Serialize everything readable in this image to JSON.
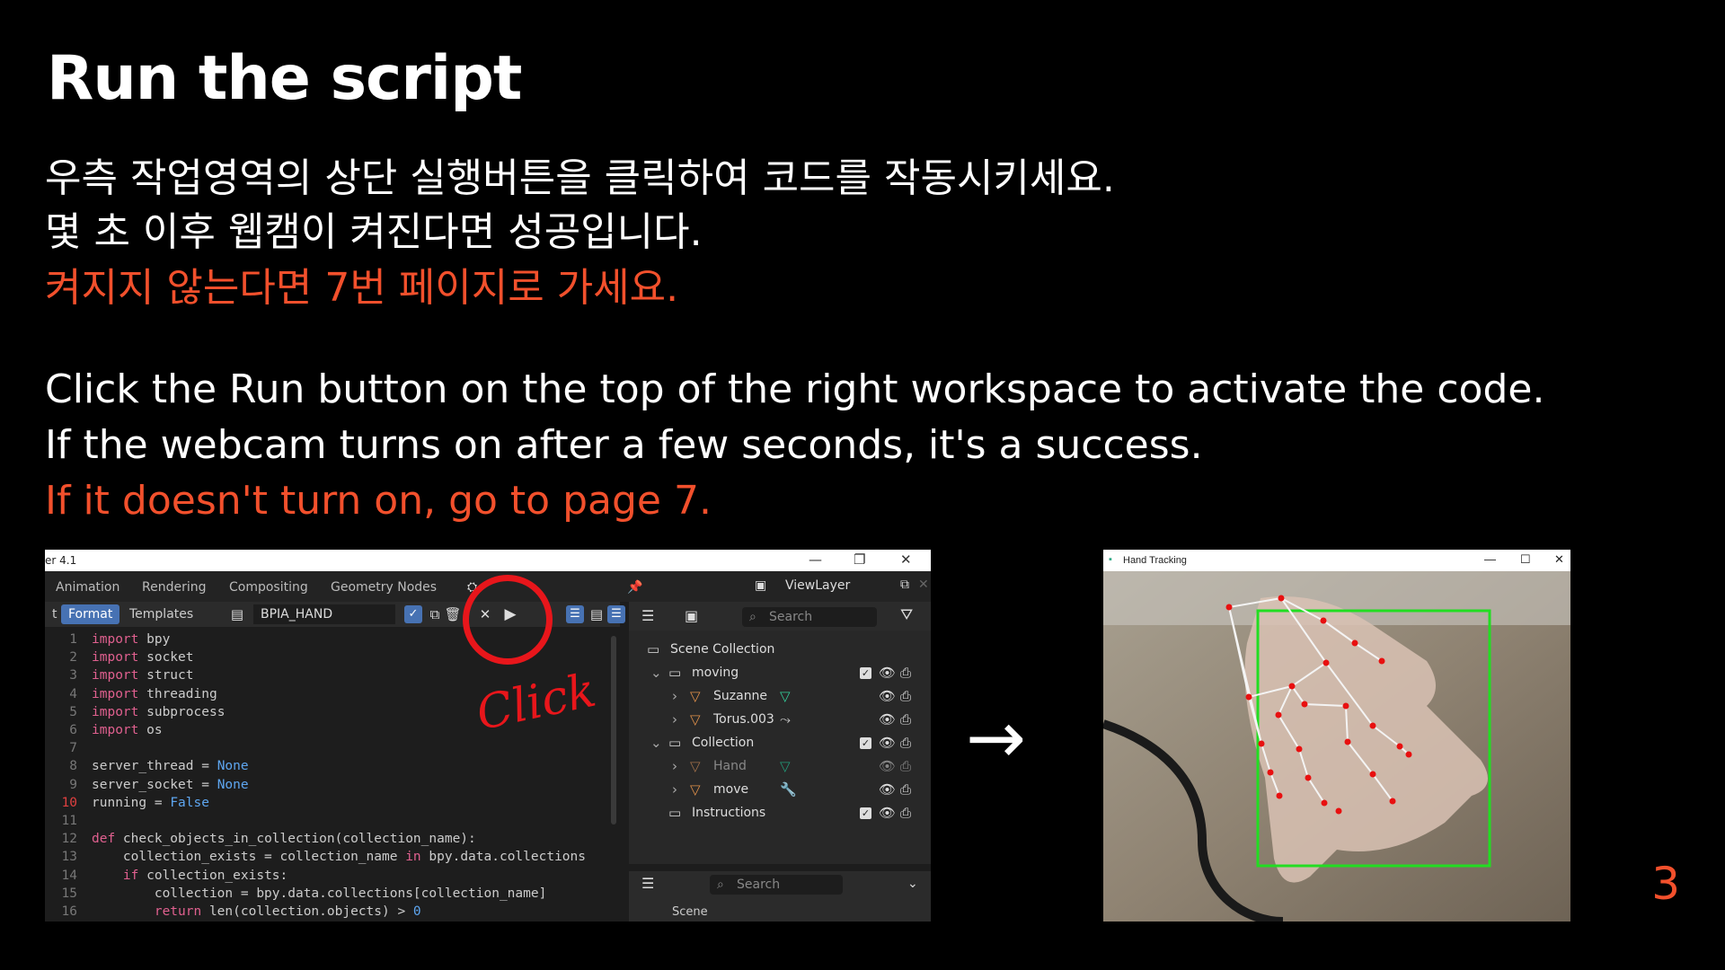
{
  "slide": {
    "title": "Run the script",
    "ko_line1": "우측 작업영역의 상단 실행버튼을 클릭하여 코드를 작동시키세요.",
    "ko_line2": "몇 초 이후 웹캠이 켜진다면 성공입니다.",
    "ko_line3": "켜지지 않는다면 7번 페이지로 가세요.",
    "en_line1": "Click the Run button on the top of the right workspace to activate the code.",
    "en_line2": "If the webcam turns on after a few seconds, it's a success.",
    "en_line3": "If it doesn't turn on, go to page 7.",
    "page_number": "3",
    "annotation_text": "Click",
    "accent_color": "#f2502c"
  },
  "blender": {
    "window_title": "er 4.1",
    "workspace_tabs": [
      "Animation",
      "Rendering",
      "Compositing",
      "Geometry Nodes"
    ],
    "editor_header": {
      "prefix": "t",
      "format_label": "Format",
      "templates_label": "Templates",
      "text_name": "BPIA_HAND",
      "run_icon": "play-icon"
    },
    "code_lines": [
      {
        "n": "1",
        "kw": "import",
        "rest": " bpy"
      },
      {
        "n": "2",
        "kw": "import",
        "rest": " socket"
      },
      {
        "n": "3",
        "kw": "import",
        "rest": " struct"
      },
      {
        "n": "4",
        "kw": "import",
        "rest": " threading"
      },
      {
        "n": "5",
        "kw": "import",
        "rest": " subprocess"
      },
      {
        "n": "6",
        "kw": "import",
        "rest": " os"
      },
      {
        "n": "7",
        "kw": "",
        "rest": ""
      },
      {
        "n": "8",
        "kw": "",
        "rest": "server_thread = ",
        "val": "None"
      },
      {
        "n": "9",
        "kw": "",
        "rest": "server_socket = ",
        "val": "None"
      },
      {
        "n": "10",
        "kw": "",
        "rest": "running = ",
        "val": "False"
      },
      {
        "n": "11",
        "kw": "",
        "rest": ""
      },
      {
        "n": "12",
        "kw": "def",
        "rest": " check_objects_in_collection(collection_name):"
      },
      {
        "n": "13",
        "kw": "",
        "rest": "    collection_exists = collection_name ",
        "kw2": "in",
        "rest2": " bpy.data.collections"
      },
      {
        "n": "14",
        "kw": "    if",
        "rest": " collection_exists:"
      },
      {
        "n": "15",
        "kw": "",
        "rest": "        collection = bpy.data.collections[collection_name]"
      },
      {
        "n": "16",
        "kw": "        return",
        "rest": " len(collection.objects) > ",
        "val": "0"
      }
    ],
    "outliner": {
      "view_layer": "ViewLayer",
      "search_placeholder": "Search",
      "scene_collection": "Scene Collection",
      "items": [
        {
          "label": "moving",
          "type": "collection"
        },
        {
          "label": "Suzanne",
          "type": "mesh"
        },
        {
          "label": "Torus.003",
          "type": "mesh"
        },
        {
          "label": "Collection",
          "type": "collection"
        },
        {
          "label": "Hand",
          "type": "mesh"
        },
        {
          "label": "move",
          "type": "mesh"
        },
        {
          "label": "Instructions",
          "type": "collection"
        }
      ]
    },
    "properties": {
      "search_placeholder": "Search",
      "scene_label": "Scene"
    }
  },
  "hand_window": {
    "title": "Hand Tracking",
    "landmark_color": "#e81010",
    "box_color": "#22dd22"
  }
}
